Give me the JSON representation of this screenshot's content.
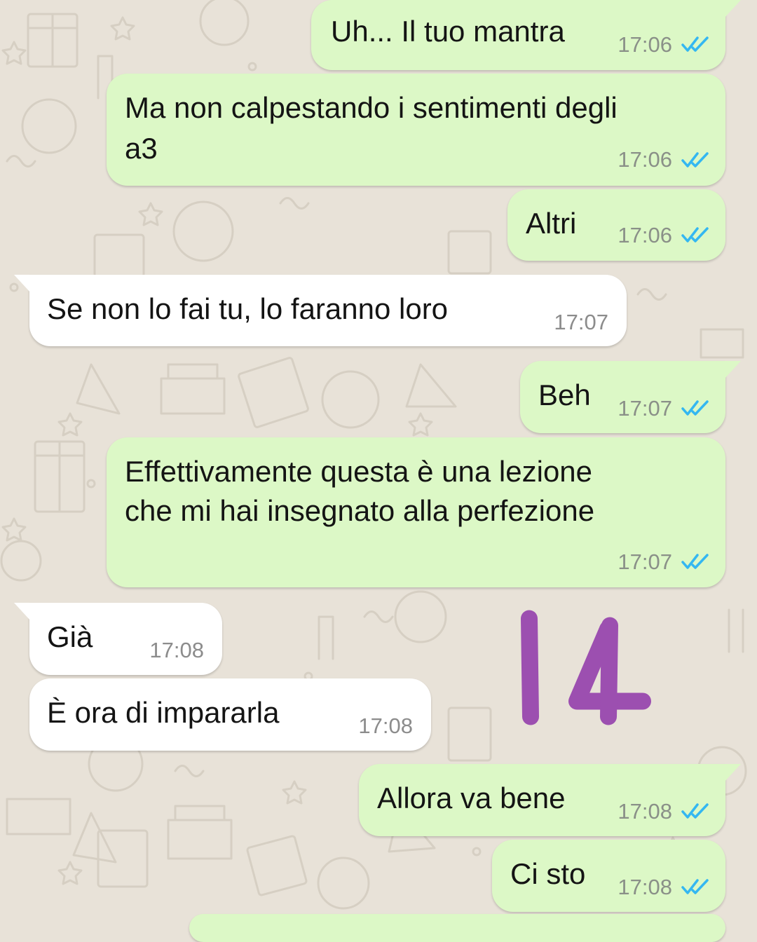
{
  "theme": {
    "background": "#e8e2d8",
    "outgoing_bubble": "#dcf8c6",
    "incoming_bubble": "#ffffff",
    "read_ticks": "#34b7f1",
    "sticker_color": "#9c4fb0"
  },
  "messages": [
    {
      "direction": "out",
      "text": "Uh... Il tuo mantra",
      "time": "17:06",
      "status": "read"
    },
    {
      "direction": "out",
      "text_lines": [
        "Ma non calpestando i sentimenti degli",
        "a3"
      ],
      "time": "17:06",
      "status": "read"
    },
    {
      "direction": "out",
      "text": "Altri",
      "time": "17:06",
      "status": "read"
    },
    {
      "direction": "in",
      "text": "Se non lo fai tu, lo faranno loro",
      "time": "17:07"
    },
    {
      "direction": "out",
      "text": "Beh",
      "time": "17:07",
      "status": "read"
    },
    {
      "direction": "out",
      "text_lines": [
        "Effettivamente questa è una lezione",
        "che mi hai insegnato alla perfezione"
      ],
      "time": "17:07",
      "status": "read"
    },
    {
      "direction": "in",
      "text": "Già",
      "time": "17:08"
    },
    {
      "direction": "in",
      "text": "È ora di impararla",
      "time": "17:08"
    },
    {
      "direction": "out",
      "text": "Allora va bene",
      "time": "17:08",
      "status": "read"
    },
    {
      "direction": "out",
      "text": "Ci sto",
      "time": "17:08",
      "status": "read"
    }
  ],
  "annotation": {
    "text": "14",
    "kind": "handwritten-number"
  },
  "icons": {
    "read_receipt": "double-check-icon"
  }
}
